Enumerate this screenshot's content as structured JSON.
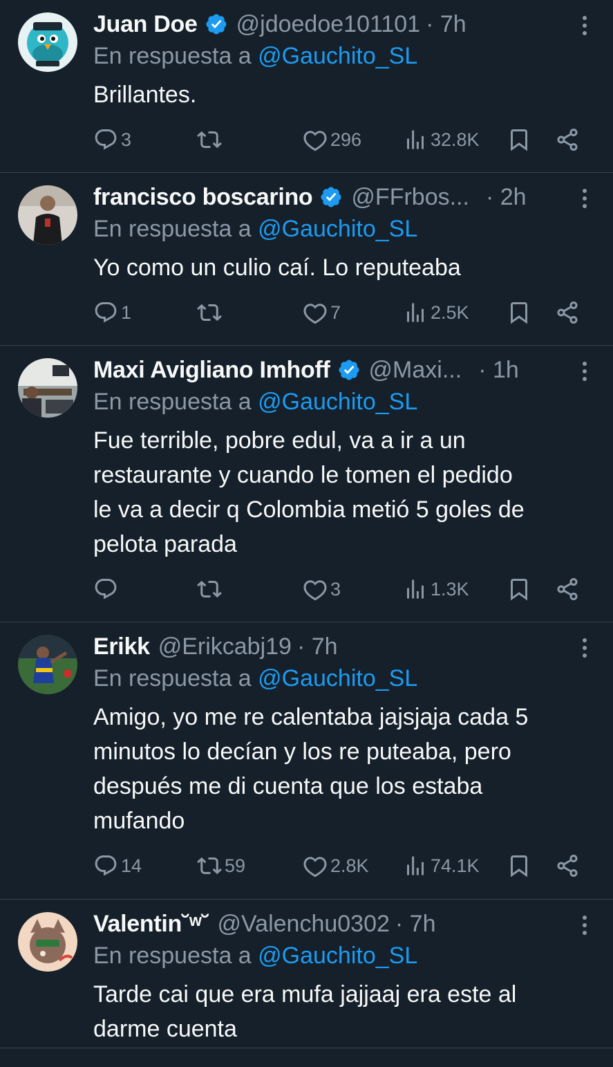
{
  "reply_prefix": "En respuesta a",
  "colors": {
    "background": "#15202b",
    "accent": "#1d9bf0",
    "muted": "#8b98a5",
    "verified": "#1d9bf0"
  },
  "tweets": [
    {
      "name": "Juan Doe",
      "verified": true,
      "handle": "@jdoedoe101101",
      "time": "· 7h",
      "reply_to": "@Gauchito_SL",
      "text": "Brillantes.",
      "replies": "3",
      "retweets": "",
      "likes": "296",
      "views": "32.8K"
    },
    {
      "name": "francisco boscarino",
      "verified": true,
      "handle": "@FFrbos...",
      "time": "· 2h",
      "reply_to": "@Gauchito_SL",
      "text": "Yo como un culio caí. Lo reputeaba",
      "replies": "1",
      "retweets": "",
      "likes": "7",
      "views": "2.5K"
    },
    {
      "name": "Maxi Avigliano Imhoff",
      "verified": true,
      "handle": "@Maxi...",
      "time": "· 1h",
      "reply_to": "@Gauchito_SL",
      "text": "Fue terrible, pobre edul, va a ir a un\nrestaurante y cuando le tomen el pedido\nle va a decir q Colombia metió 5 goles de\npelota parada",
      "replies": "",
      "retweets": "",
      "likes": "3",
      "views": "1.3K"
    },
    {
      "name": "Erikk",
      "verified": false,
      "handle": "@Erikcabj19",
      "time": "· 7h",
      "reply_to": "@Gauchito_SL",
      "text": "Amigo, yo me re calentaba jajsjaja cada 5\nminutos lo decían y los re puteaba, pero\ndespués me di cuenta que los estaba\nmufando",
      "replies": "14",
      "retweets": "59",
      "likes": "2.8K",
      "views": "74.1K"
    },
    {
      "name": "Valentin˘ʷ˘",
      "verified": false,
      "handle": "@Valenchu0302",
      "time": "· 7h",
      "reply_to": "@Gauchito_SL",
      "text": "Tarde cai que era mufa jajjaaj era este al\ndarme cuenta",
      "replies": "",
      "retweets": "",
      "likes": "",
      "views": ""
    }
  ]
}
